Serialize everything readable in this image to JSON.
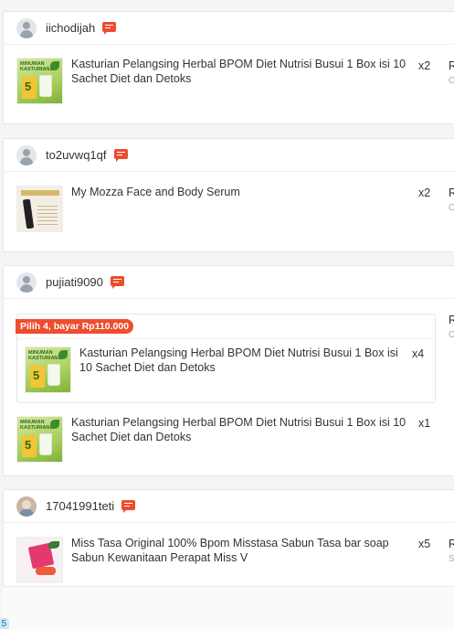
{
  "orders": [
    {
      "username": "iichodijah",
      "items": [
        {
          "name": "Kasturian Pelangsing Herbal BPOM Diet Nutrisi Busui 1 Box isi 10 Sachet Diet dan Detoks",
          "qty": "x2",
          "thumb": "kasturian"
        }
      ]
    },
    {
      "username": "to2uvwq1qf",
      "items": [
        {
          "name": "My Mozza Face and Body Serum",
          "qty": "x2",
          "thumb": "serum"
        }
      ]
    },
    {
      "username": "pujiati9090",
      "bundle": {
        "tag": "Pilih 4, bayar Rp110.000",
        "item": {
          "name": "Kasturian Pelangsing Herbal BPOM Diet Nutrisi Busui 1 Box isi 10 Sachet Diet dan Detoks",
          "qty": "x4",
          "thumb": "kasturian"
        }
      },
      "items": [
        {
          "name": "Kasturian Pelangsing Herbal BPOM Diet Nutrisi Busui 1 Box isi 10 Sachet Diet dan Detoks",
          "qty": "x1",
          "thumb": "kasturian"
        }
      ]
    },
    {
      "username": "17041991teti",
      "items": [
        {
          "name": "Miss Tasa Original 100% Bpom Misstasa Sabun Tasa bar soap Sabun Kewanitaan Perapat Miss V",
          "qty": "x5",
          "thumb": "tasa"
        }
      ]
    }
  ],
  "cutoff": {
    "price_glyph": "R",
    "sub_glyph_c": "C",
    "sub_glyph_s": "S"
  },
  "corner_badge": "5",
  "colors": {
    "accent": "#ee4d2d",
    "border": "#e5e5e5"
  }
}
